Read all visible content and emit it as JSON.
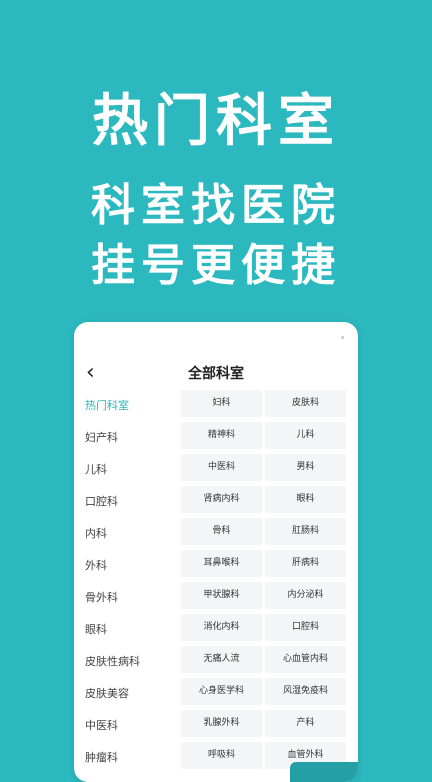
{
  "hero": {
    "line1": "热门科室",
    "line2": "科室找医院",
    "line3": "挂号更便捷"
  },
  "nav": {
    "back_icon": "chevron-left-icon",
    "back_glyph": "‹",
    "title": "全部科室"
  },
  "sidebar": {
    "items": [
      {
        "label": "热门科室",
        "active": true
      },
      {
        "label": "妇产科",
        "active": false
      },
      {
        "label": "儿科",
        "active": false
      },
      {
        "label": "口腔科",
        "active": false
      },
      {
        "label": "内科",
        "active": false
      },
      {
        "label": "外科",
        "active": false
      },
      {
        "label": "骨外科",
        "active": false
      },
      {
        "label": "眼科",
        "active": false
      },
      {
        "label": "皮肤性病科",
        "active": false
      },
      {
        "label": "皮肤美容",
        "active": false
      },
      {
        "label": "中医科",
        "active": false
      },
      {
        "label": "肿瘤科",
        "active": false
      }
    ]
  },
  "departments": [
    "妇科",
    "皮肤科",
    "精神科",
    "儿科",
    "中医科",
    "男科",
    "肾病内科",
    "眼科",
    "骨科",
    "肛肠科",
    "耳鼻喉科",
    "肝病科",
    "甲状腺科",
    "内分泌科",
    "消化内科",
    "口腔科",
    "无痛人流",
    "心血管内科",
    "心身医学科",
    "风湿免疫科",
    "乳腺外科",
    "产科",
    "呼吸科",
    "血管外科"
  ],
  "colors": {
    "brand": "#2bb8be",
    "active_text": "#2bb8be",
    "tile_bg": "#f3f5f6"
  }
}
